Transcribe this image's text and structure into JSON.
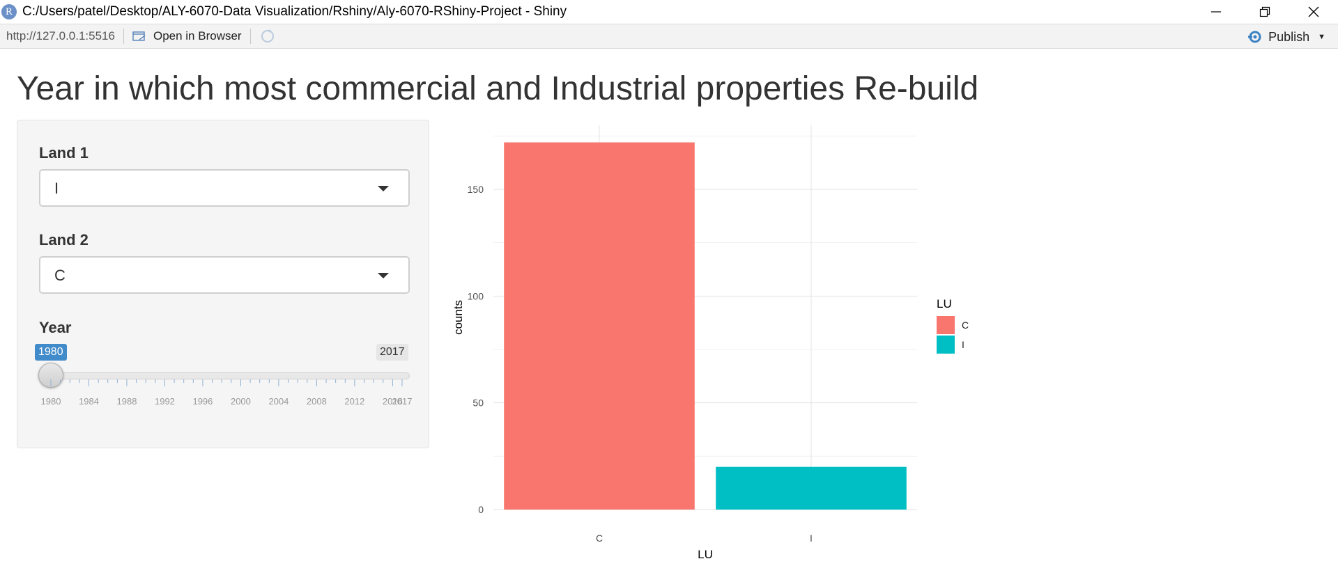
{
  "window": {
    "title": "C:/Users/patel/Desktop/ALY-6070-Data Visualization/Rshiny/Aly-6070-RShiny-Project - Shiny",
    "app_icon_letter": "R"
  },
  "toolbar": {
    "url": "http://127.0.0.1:5516",
    "open_in_browser": "Open in Browser",
    "publish": "Publish"
  },
  "page": {
    "title": "Year in which most commercial and Industrial properties Re-build"
  },
  "sidebar": {
    "land1": {
      "label": "Land 1",
      "value": "I"
    },
    "land2": {
      "label": "Land 2",
      "value": "C"
    },
    "year": {
      "label": "Year",
      "min": 1980,
      "max": 2017,
      "value": 1980,
      "min_label": "1980",
      "max_label": "2017",
      "tick_labels": [
        "1980",
        "1984",
        "1988",
        "1992",
        "1996",
        "2000",
        "2004",
        "2008",
        "2012",
        "2016",
        "2017"
      ]
    }
  },
  "chart_data": {
    "type": "bar",
    "categories": [
      "C",
      "I"
    ],
    "values": [
      172,
      20
    ],
    "colors": [
      "#F8766D",
      "#00BFC4"
    ],
    "xlabel": "LU",
    "ylabel": "counts",
    "ylim": [
      0,
      180
    ],
    "yticks": [
      0,
      50,
      100,
      150
    ],
    "grid": true,
    "legend": {
      "title": "LU",
      "entries": [
        "C",
        "I"
      ],
      "placement": "right"
    }
  }
}
